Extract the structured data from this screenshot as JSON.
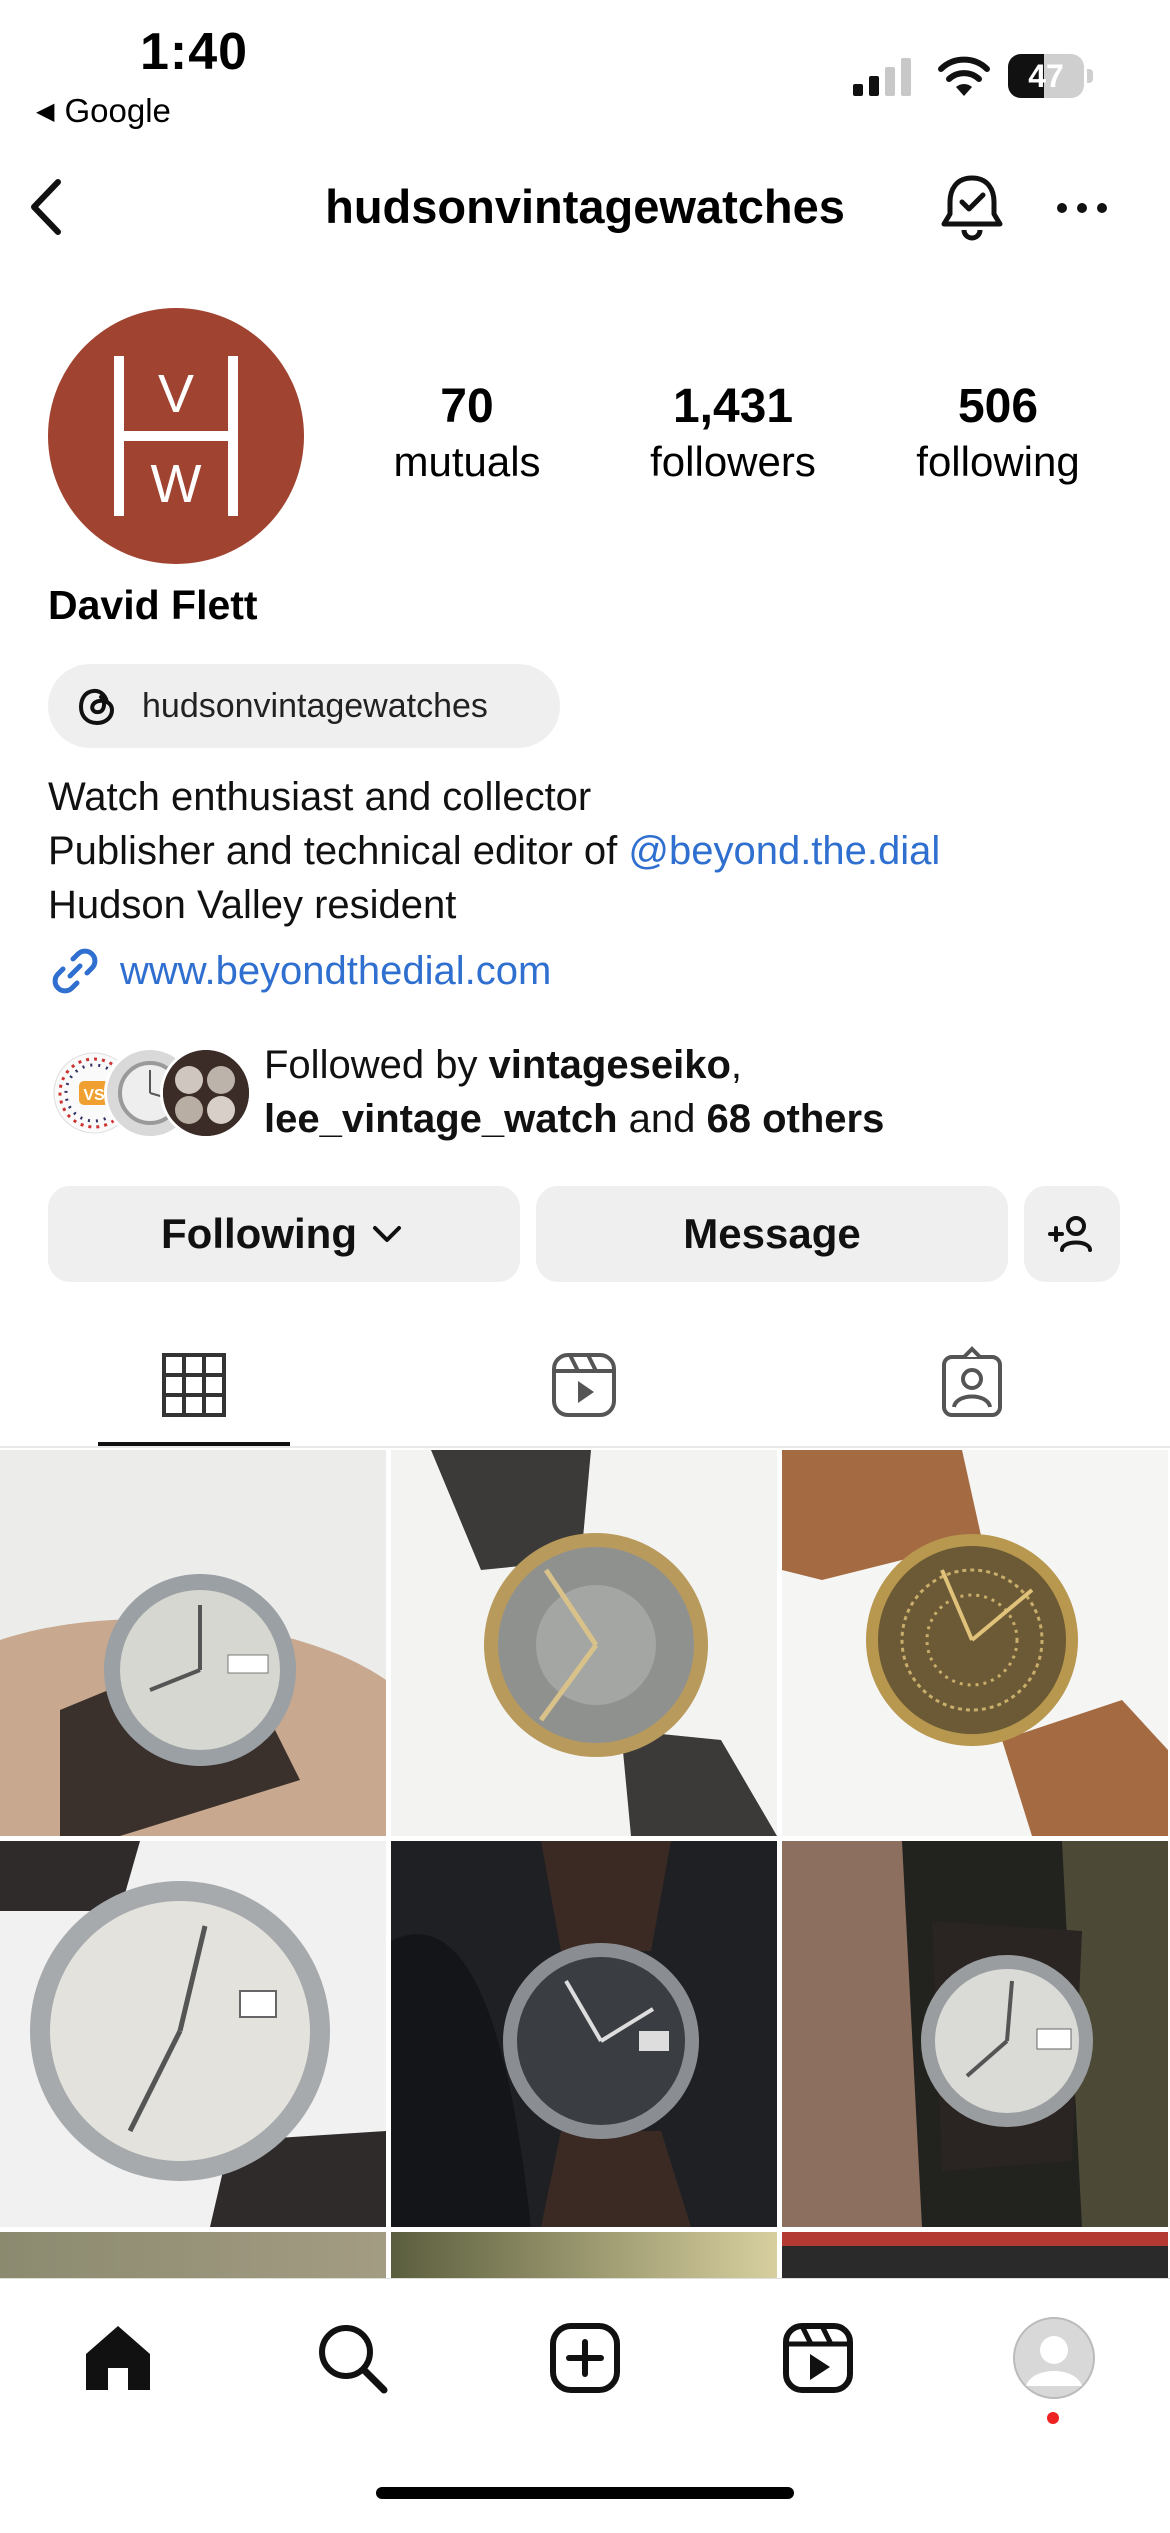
{
  "status_bar": {
    "time": "1:40",
    "back_app": "Google",
    "battery": "47",
    "battery_level": 0.47
  },
  "header": {
    "username": "hudsonvintagewatches",
    "icons": [
      "chevron-left-icon",
      "bell-check-icon",
      "more-icon"
    ]
  },
  "profile": {
    "avatar_letters": {
      "top": "V",
      "middle": "H",
      "bottom": "W"
    },
    "avatar_color": "#a14331",
    "stats": [
      {
        "value": "70",
        "label": "mutuals"
      },
      {
        "value": "1,431",
        "label": "followers"
      },
      {
        "value": "506",
        "label": "following"
      }
    ],
    "display_name": "David Flett",
    "threads_handle": "hudsonvintagewatches",
    "bio": {
      "line1": "Watch enthusiast and collector",
      "line2_prefix": "Publisher and technical editor of ",
      "line2_mention": "@beyond.the.dial",
      "line3": "Hudson Valley resident"
    },
    "website": "www.beyondthedial.com",
    "followed_by": {
      "prefix": "Followed by ",
      "user1": "vintageseiko",
      "comma": ",",
      "user2": "lee_vintage_watch",
      "and": " and ",
      "others": "68 others"
    }
  },
  "actions": {
    "following": "Following",
    "message": "Message"
  },
  "tabs": [
    "posts-grid",
    "reels",
    "tagged"
  ],
  "accent_link_color": "#2f6fcf",
  "bottom_nav": [
    "home-icon",
    "search-icon",
    "create-icon",
    "reels-icon",
    "profile-avatar"
  ]
}
